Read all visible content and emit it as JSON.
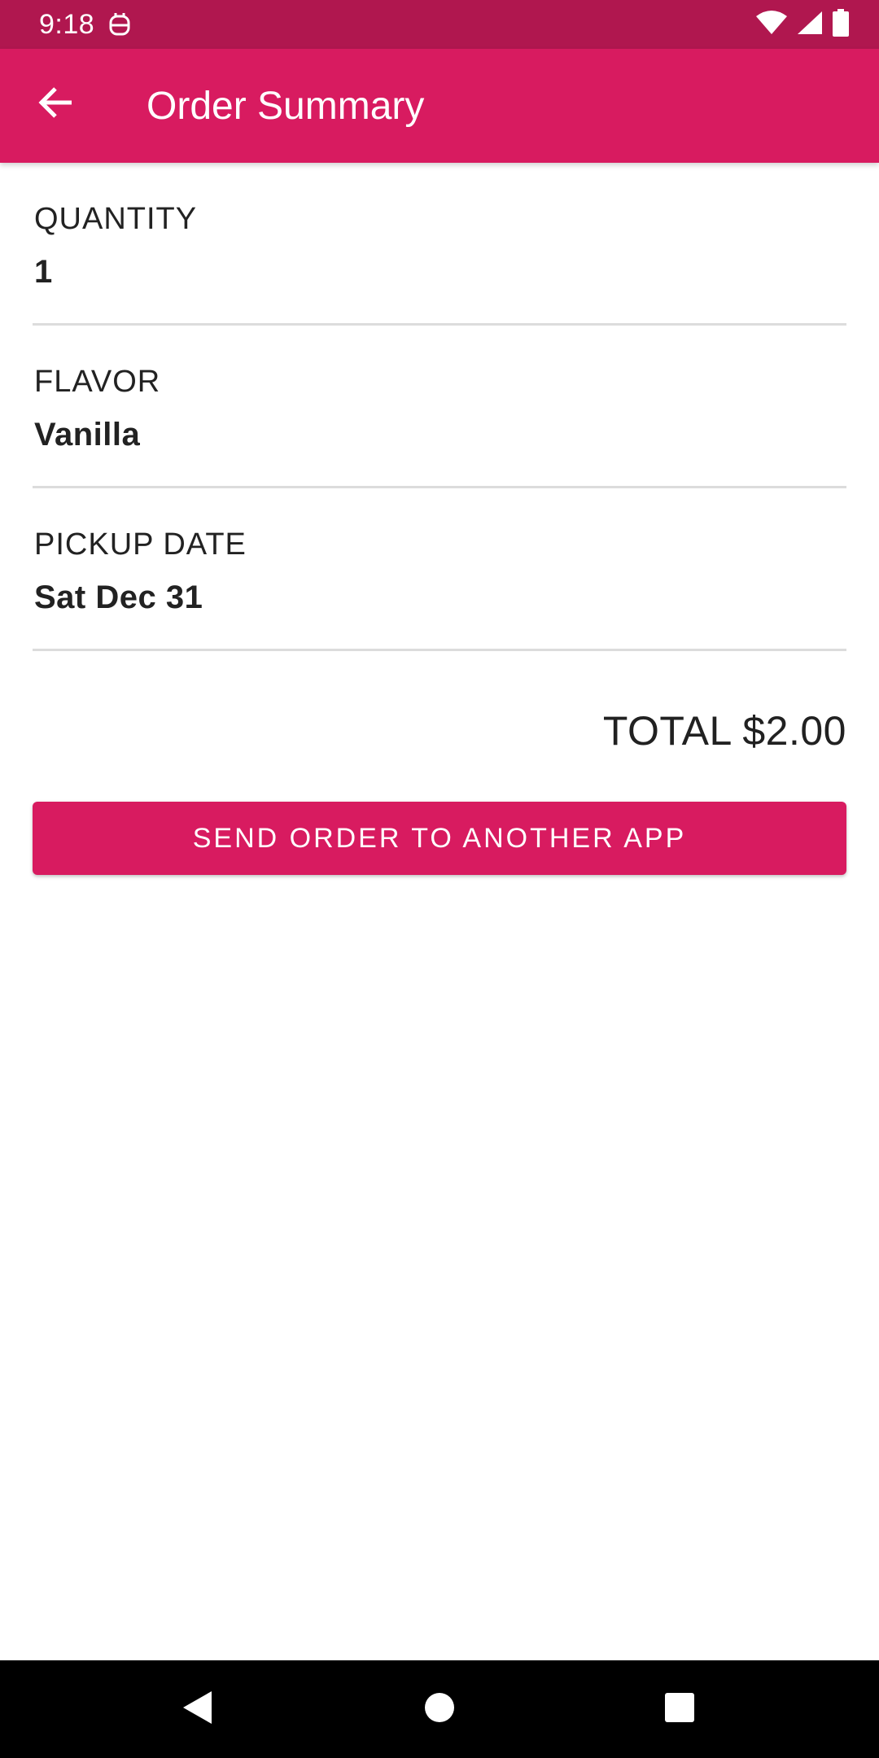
{
  "status_bar": {
    "time": "9:18",
    "app_icon": "notification-app-icon",
    "wifi_icon": "wifi-icon",
    "signal_icon": "signal-icon",
    "battery_icon": "battery-icon"
  },
  "app_bar": {
    "title": "Order Summary",
    "back_icon": "arrow-back-icon"
  },
  "summary": {
    "rows": [
      {
        "label": "QUANTITY",
        "value": "1"
      },
      {
        "label": "FLAVOR",
        "value": "Vanilla"
      },
      {
        "label": "PICKUP DATE",
        "value": "Sat Dec 31"
      }
    ],
    "total": "TOTAL $2.00"
  },
  "actions": {
    "send_label": "SEND ORDER TO ANOTHER APP"
  },
  "nav_bar": {
    "back_icon": "nav-back-icon",
    "home_icon": "nav-home-icon",
    "recents_icon": "nav-recents-icon"
  },
  "colors": {
    "status_bar": "#b0174f",
    "primary": "#d81b60",
    "divider": "#dcdcdc",
    "text": "#212121"
  }
}
